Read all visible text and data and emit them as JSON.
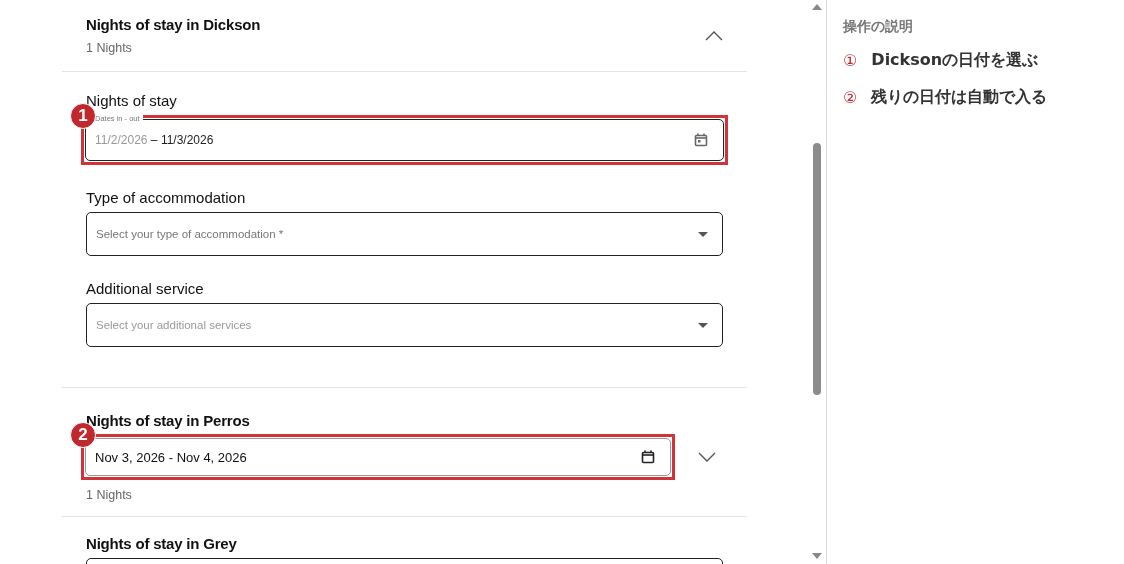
{
  "sections": [
    {
      "kind": "open",
      "title": "Nights of stay in Dickson",
      "subtitle": "1 Nights",
      "expanded": true,
      "fields": [
        {
          "kind": "daterange",
          "label": "Nights of stay",
          "floating_label": "Dates in - out",
          "start": "11/2/2026",
          "separator": "–",
          "end": "11/3/2026",
          "marker": "1"
        },
        {
          "kind": "select",
          "label": "Type of accommodation",
          "placeholder": "Select your type of accommodation *"
        },
        {
          "kind": "select",
          "label": "Additional service",
          "placeholder": "Select your additional services"
        }
      ]
    },
    {
      "kind": "closed",
      "title": "Nights of stay in Perros",
      "value": "Nov 3, 2026 - Nov 4, 2026",
      "marker": "2",
      "subtitle": "1 Nights",
      "expanded": false
    },
    {
      "kind": "cut",
      "title": "Nights of stay in Grey"
    }
  ],
  "help": {
    "heading": "操作の説明",
    "steps": [
      {
        "number": "①",
        "text": "Dicksonの日付を選ぶ"
      },
      {
        "number": "②",
        "text": "残りの日付は自動で入る"
      }
    ]
  }
}
